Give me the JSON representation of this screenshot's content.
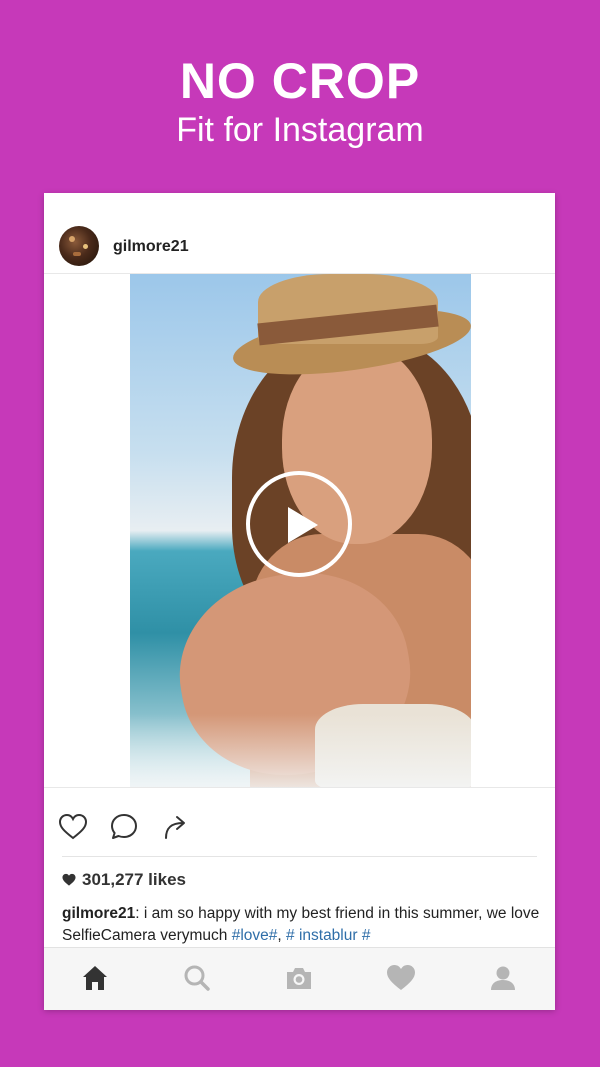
{
  "promo": {
    "headline": "NO CROP",
    "subheadline": "Fit for Instagram"
  },
  "colors": {
    "background": "#c639b9",
    "card": "#ffffff",
    "hashtag": "#2f6ea8",
    "text": "#222222",
    "nav_active": "#333333",
    "nav_inactive": "#b5b5b5"
  },
  "post": {
    "username": "gilmore21",
    "media": {
      "type": "video",
      "overlay_icon": "play-icon"
    },
    "actions": [
      "heart-icon",
      "comment-icon",
      "share-icon"
    ],
    "likes": "301,277 likes",
    "caption": {
      "username": "gilmore21",
      "text_part1": ": i am so happy with my best friend in this summer, we love SelfieCamera verymuch ",
      "tag1": "#love#",
      "separator": ",  ",
      "tag2": "# instablur #"
    }
  },
  "navbar": {
    "items": [
      {
        "icon": "home-icon",
        "active": true
      },
      {
        "icon": "search-icon",
        "active": false
      },
      {
        "icon": "camera-icon",
        "active": false
      },
      {
        "icon": "heart-icon",
        "active": false
      },
      {
        "icon": "profile-icon",
        "active": false
      }
    ]
  }
}
